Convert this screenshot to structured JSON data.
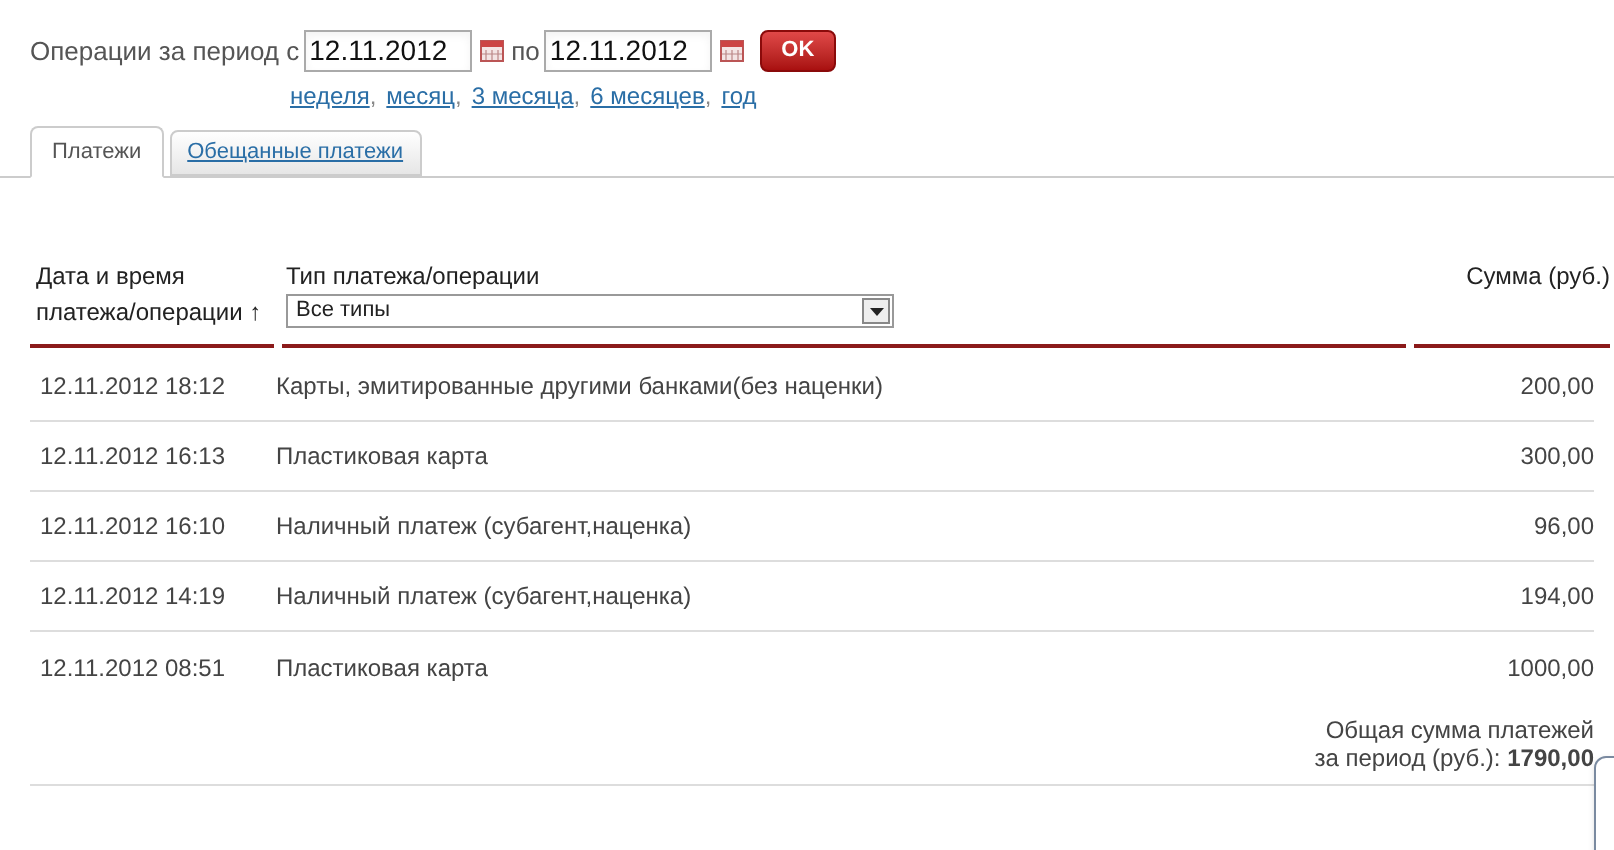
{
  "period": {
    "label": "Операции за период с",
    "from": "12.11.2012",
    "to_label": "по",
    "to": "12.11.2012",
    "ok_button": "OK"
  },
  "quick_links": [
    {
      "label": "неделя",
      "sep": ","
    },
    {
      "label": "месяц",
      "sep": ","
    },
    {
      "label": "3 месяца",
      "sep": ","
    },
    {
      "label": "6 месяцев",
      "sep": ","
    },
    {
      "label": "год"
    }
  ],
  "tabs": [
    {
      "label": "Платежи",
      "selected": true
    },
    {
      "label": "Обещанные платежи",
      "selected": false
    }
  ],
  "table": {
    "columns": [
      {
        "label": "Дата и время платежа/операции",
        "sort": "↑"
      },
      {
        "label": "Тип платежа/операции",
        "filter": "Все типы"
      },
      {
        "label": "Сумма (руб.)"
      }
    ],
    "rows": [
      {
        "date": "12.11.2012 18:12",
        "type": "Карты, эмитированные другими банками(без наценки)",
        "amount": "200,00"
      },
      {
        "date": "12.11.2012 16:13",
        "type": "Пластиковая карта",
        "amount": "300,00"
      },
      {
        "date": "12.11.2012 16:10",
        "type": "Наличный платеж (субагент,наценка)",
        "amount": "96,00"
      },
      {
        "date": "12.11.2012 14:19",
        "type": "Наличный платеж (субагент,наценка)",
        "amount": "194,00"
      },
      {
        "date": "12.11.2012 08:51",
        "type": "Пластиковая карта",
        "amount": "1000,00"
      }
    ]
  },
  "total": {
    "line1": "Общая сумма платежей",
    "line2": "за период (руб.): **1790,00**"
  }
}
